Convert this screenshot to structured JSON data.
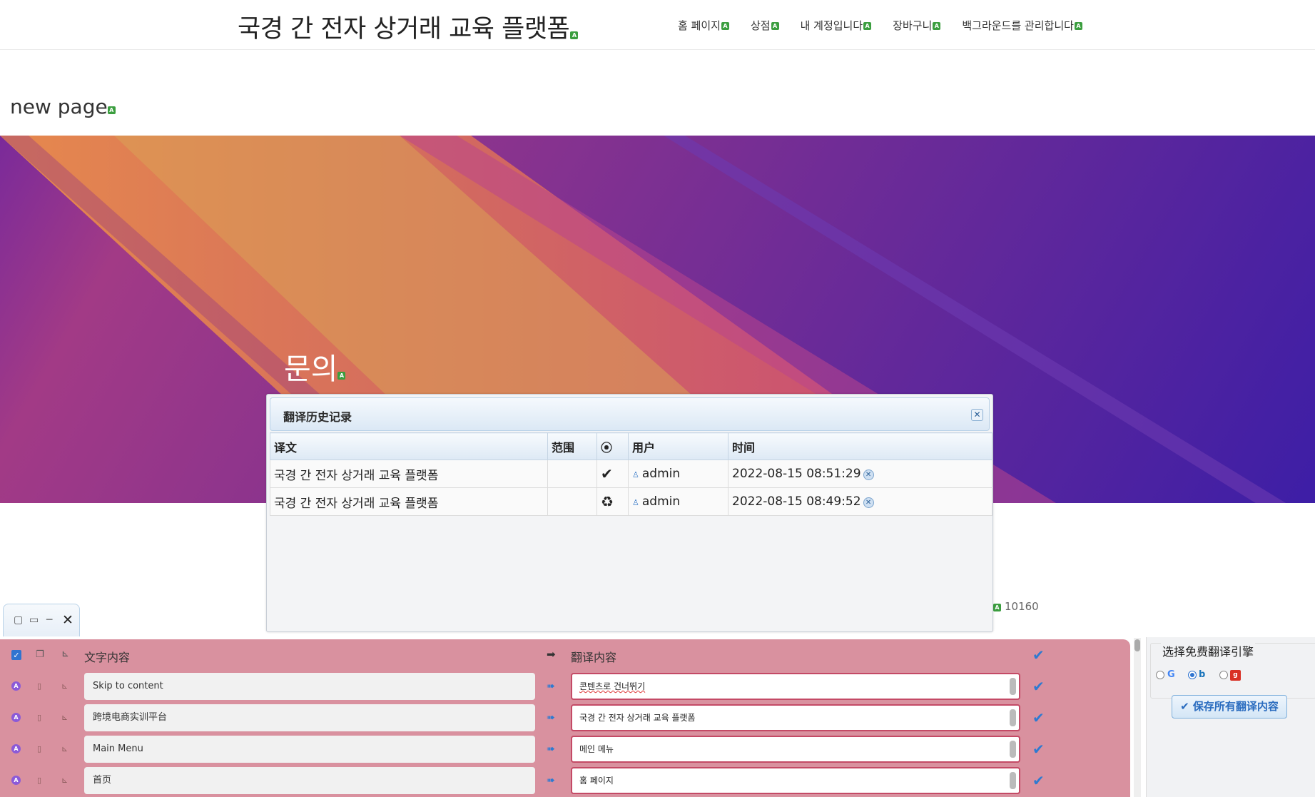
{
  "header": {
    "site_title": "국경 간 전자 상거래 교육 플랫폼",
    "badge": "A",
    "nav": [
      {
        "label": "홈 페이지"
      },
      {
        "label": "상점"
      },
      {
        "label": "내 계정입니다"
      },
      {
        "label": "장바구니"
      },
      {
        "label": "백그라운드를 관리합니다"
      }
    ]
  },
  "page": {
    "heading": "new page",
    "hero_title": "문의",
    "footer_number": "10160"
  },
  "history_dialog": {
    "title": "翻译历史记录",
    "columns": {
      "translation": "译文",
      "scope": "范围",
      "status": "⦿",
      "user": "用户",
      "time": "时间"
    },
    "rows": [
      {
        "translation": "국경 간 전자 상거래 교육 플랫폼",
        "scope": "",
        "status": "✔",
        "user": "admin",
        "time": "2022-08-15 08:51:29"
      },
      {
        "translation": "국경 간 전자 상거래 교육 플랫폼",
        "scope": "",
        "status": "♻",
        "user": "admin",
        "time": "2022-08-15 08:49:52"
      }
    ]
  },
  "translation_panel": {
    "source_header": "文字内容",
    "target_header": "翻译内容",
    "rows": [
      {
        "source": "Skip to content",
        "target": "콘텐츠로 건너뛰기"
      },
      {
        "source": "跨境电商实训平台",
        "target": "국경 간 전자 상거래 교육 플랫폼"
      },
      {
        "source": "Main Menu",
        "target": "메인 메뉴"
      },
      {
        "source": "首页",
        "target": "홈 페이지"
      }
    ]
  },
  "engine": {
    "legend": "选择免费翻译引擎",
    "selected": "bing",
    "save_label": "✔ 保存所有翻译内容"
  }
}
